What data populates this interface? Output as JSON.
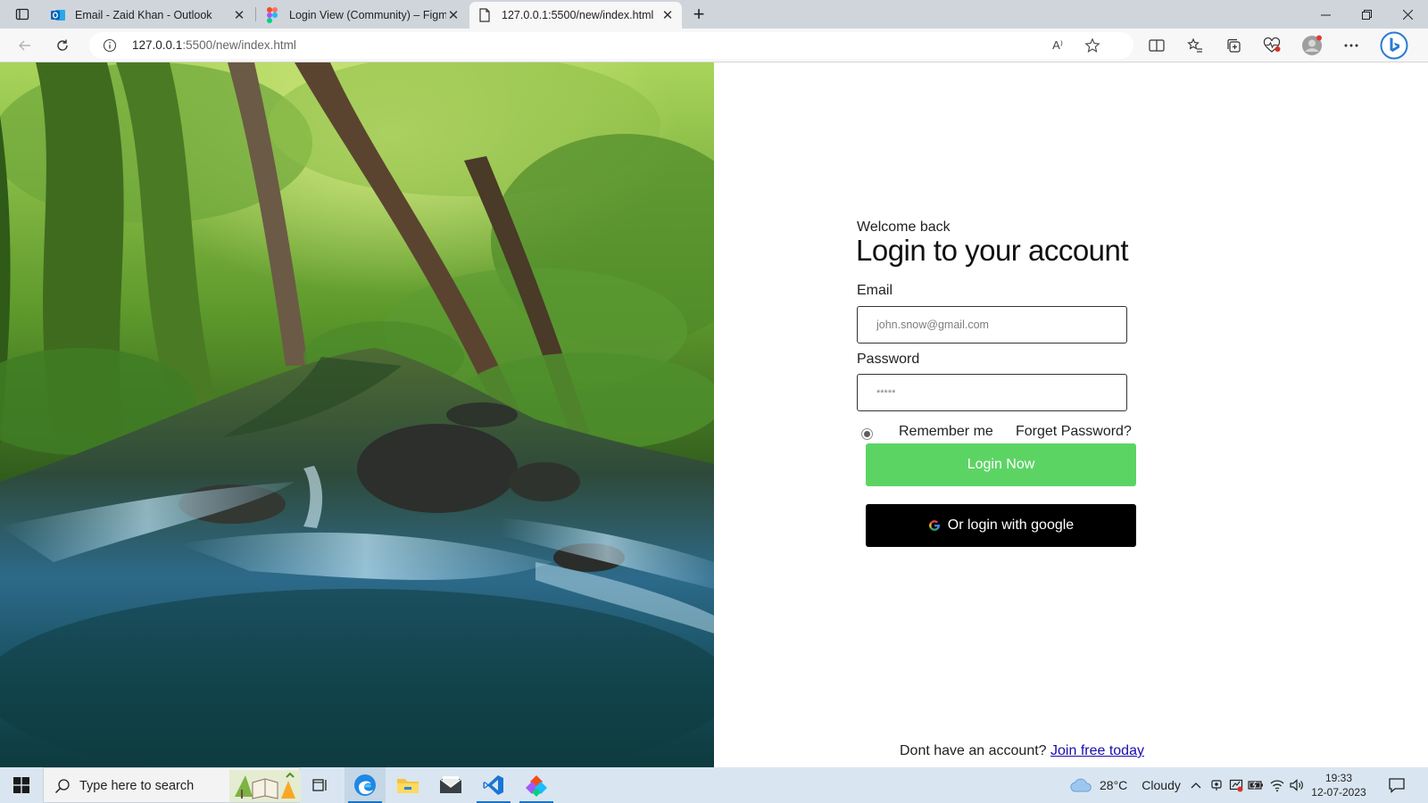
{
  "browser": {
    "tabs": [
      {
        "title": "Email - Zaid Khan - Outlook",
        "icon": "outlook-icon",
        "active": false
      },
      {
        "title": "Login View (Community) – Figma",
        "icon": "figma-icon",
        "active": false
      },
      {
        "title": "127.0.0.1:5500/new/index.html",
        "icon": "page-icon",
        "active": true
      }
    ],
    "address": {
      "host": "127.0.0.1",
      "path": ":5500/new/index.html"
    },
    "read_aloud_label": "A⁾"
  },
  "login": {
    "welcome": "Welcome back",
    "heading": "Login to your account",
    "email_label": "Email",
    "email_placeholder": "john.snow@gmail.com",
    "password_label": "Password",
    "password_placeholder": "*****",
    "remember_label": "Remember me",
    "forgot_label": "Forget Password?",
    "login_button": "Login Now",
    "google_button": "Or login with google",
    "signup_prompt": "Dont have an account?",
    "signup_link": "Join free today",
    "accent_color": "#5cd464",
    "google_button_color": "#000000"
  },
  "taskbar": {
    "search_placeholder": "Type here to search",
    "weather_temp": "28°C",
    "weather_text": "Cloudy",
    "time": "19:33",
    "date": "12-07-2023"
  }
}
